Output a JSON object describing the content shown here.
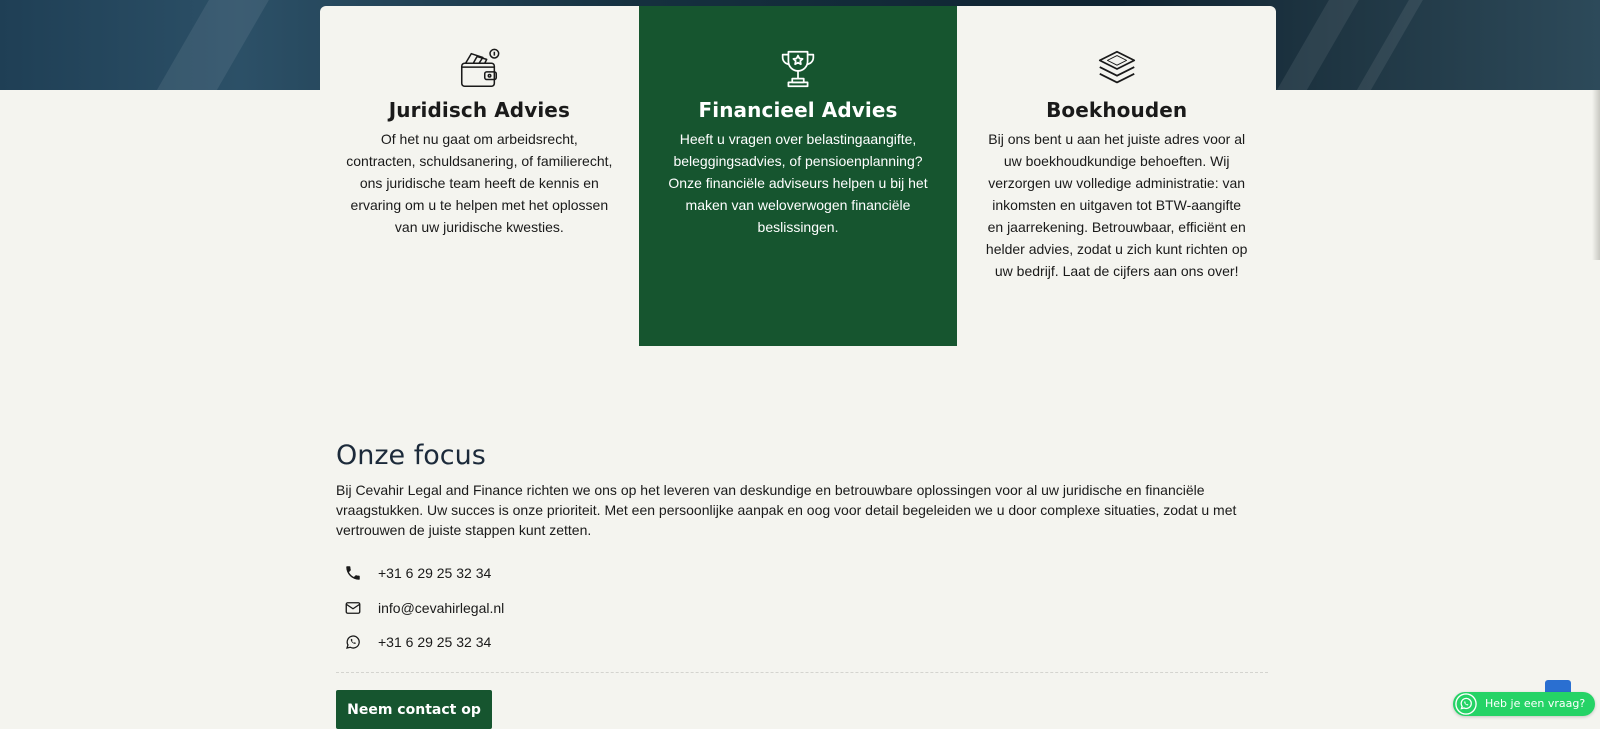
{
  "services": [
    {
      "title": "Juridisch Advies",
      "icon": "wallet-money-icon",
      "text": "Of het nu gaat om arbeidsrecht, contracten, schuldsanering, of familierecht, ons juridische team heeft de kennis en ervaring om u te helpen met het oplossen van uw juridische kwesties."
    },
    {
      "title": "Financieel Advies",
      "icon": "trophy-icon",
      "text": "Heeft u vragen over belastingaangifte, beleggingsadvies, of pensioenplanning? Onze financiële adviseurs helpen u bij het maken van weloverwogen financiële beslissingen."
    },
    {
      "title": "Boekhouden",
      "icon": "layers-icon",
      "text": "Bij ons bent u aan het juiste adres voor al uw boekhoudkundige behoeften. Wij verzorgen uw volledige administratie: van inkomsten en uitgaven tot BTW-aangifte en jaarrekening. Betrouwbaar, efficiënt en helder advies, zodat u zich kunt richten op uw bedrijf. Laat de cijfers aan ons over!"
    }
  ],
  "focus": {
    "title": "Onze focus",
    "text": "Bij Cevahir Legal and Finance richten we ons op het leveren van deskundige en betrouwbare oplossingen voor al uw juridische en financiële vraagstukken. Uw succes is onze prioriteit. Met een persoonlijke aanpak en oog voor detail begeleiden we u door complexe situaties, zodat u met vertrouwen de juiste stappen kunt zetten.",
    "contacts": [
      {
        "icon": "phone-icon",
        "value": "+31 6 29 25 32 34"
      },
      {
        "icon": "envelope-icon",
        "value": "info@cevahirlegal.nl"
      },
      {
        "icon": "whatsapp-icon",
        "value": "+31 6 29 25 32 34"
      }
    ],
    "cta_label": "Neem contact op"
  },
  "whatsapp_widget": {
    "label": "Heb je een vraag?"
  },
  "colors": {
    "brand_green": "#16552f",
    "background": "#f4f4ef",
    "whatsapp_green": "#25d366",
    "scroll_top_blue": "#2a6fd1"
  }
}
